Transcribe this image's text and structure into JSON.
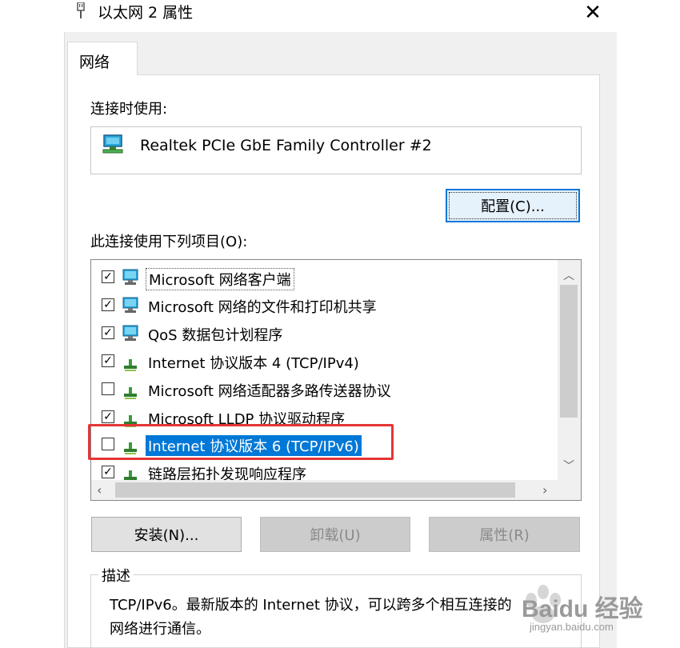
{
  "window": {
    "title": "以太网 2 属性",
    "close_glyph": "✕"
  },
  "tabs": [
    {
      "label": "网络"
    }
  ],
  "connect_using": {
    "label": "连接时使用:",
    "adapter_name": "Realtek PCIe GbE Family Controller #2",
    "configure_button": "配置(C)..."
  },
  "items_section": {
    "label": "此连接使用下列项目(O):",
    "items": [
      {
        "label": "Microsoft 网络客户端",
        "checked": true,
        "icon": "network-client-icon"
      },
      {
        "label": "Microsoft 网络的文件和打印机共享",
        "checked": true,
        "icon": "network-service-icon"
      },
      {
        "label": "QoS 数据包计划程序",
        "checked": true,
        "icon": "network-service-icon"
      },
      {
        "label": "Internet 协议版本 4 (TCP/IPv4)",
        "checked": true,
        "icon": "protocol-icon"
      },
      {
        "label": "Microsoft 网络适配器多路传送器协议",
        "checked": false,
        "icon": "protocol-icon"
      },
      {
        "label": "Microsoft LLDP 协议驱动程序",
        "checked": true,
        "icon": "protocol-icon"
      },
      {
        "label": "Internet 协议版本 6 (TCP/IPv6)",
        "checked": false,
        "icon": "protocol-icon",
        "selected": true
      },
      {
        "label": "链路层拓扑发现响应程序",
        "checked": true,
        "icon": "protocol-icon"
      }
    ]
  },
  "buttons": {
    "install": "安装(N)...",
    "uninstall": "卸载(U)",
    "properties": "属性(R)"
  },
  "description": {
    "title": "描述",
    "line1": "TCP/IPv6。最新版本的 Internet 协议，可以跨多个相互连接的",
    "line2": "网络进行通信。"
  },
  "watermark": {
    "brand": "Baidu 经验",
    "url": "jingyan.baidu.com"
  },
  "colors": {
    "selection": "#0078d7",
    "highlight_box": "#e53535",
    "window_bg": "#f0f0f0"
  }
}
